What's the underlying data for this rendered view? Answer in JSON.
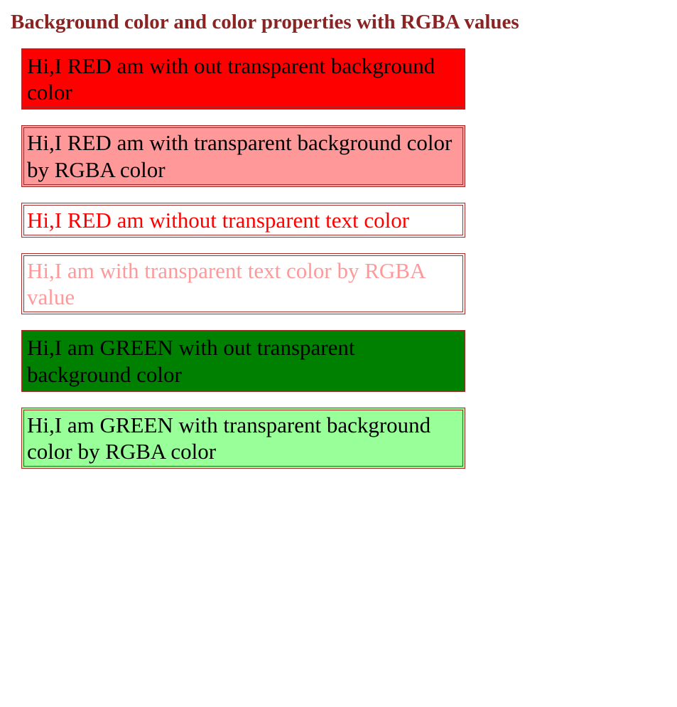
{
  "heading": {
    "text": "Background color and color properties with RGBA values",
    "color": "#8B2323"
  },
  "boxes": [
    {
      "text": "Hi,I RED am with out transparent background color",
      "bg": "#ff0000",
      "textColor": "#000000",
      "borderColor": "#A52A2A"
    },
    {
      "text": "Hi,I RED am with transparent background color by RGBA color",
      "bg": "rgba(255,0,0,0.4)",
      "textColor": "#000000",
      "borderColor": "#A52A2A"
    },
    {
      "text": "Hi,I RED am without transparent text color",
      "bg": "#ffffff",
      "textColor": "#ff0000",
      "borderColor": "#A52A2A"
    },
    {
      "text": "Hi,I am with transparent text color by RGBA value",
      "bg": "#ffffff",
      "textColor": "rgba(255,0,0,0.4)",
      "borderColor": "#A52A2A"
    },
    {
      "text": "Hi,I am GREEN with out transparent background color",
      "bg": "#008000",
      "textColor": "#000000",
      "borderColor": "#A52A2A"
    },
    {
      "text": "Hi,I am GREEN with transparent background color by RGBA color",
      "bg": "rgba(0,255,0,0.4)",
      "textColor": "#000000",
      "borderColor": "#A52A2A"
    }
  ]
}
